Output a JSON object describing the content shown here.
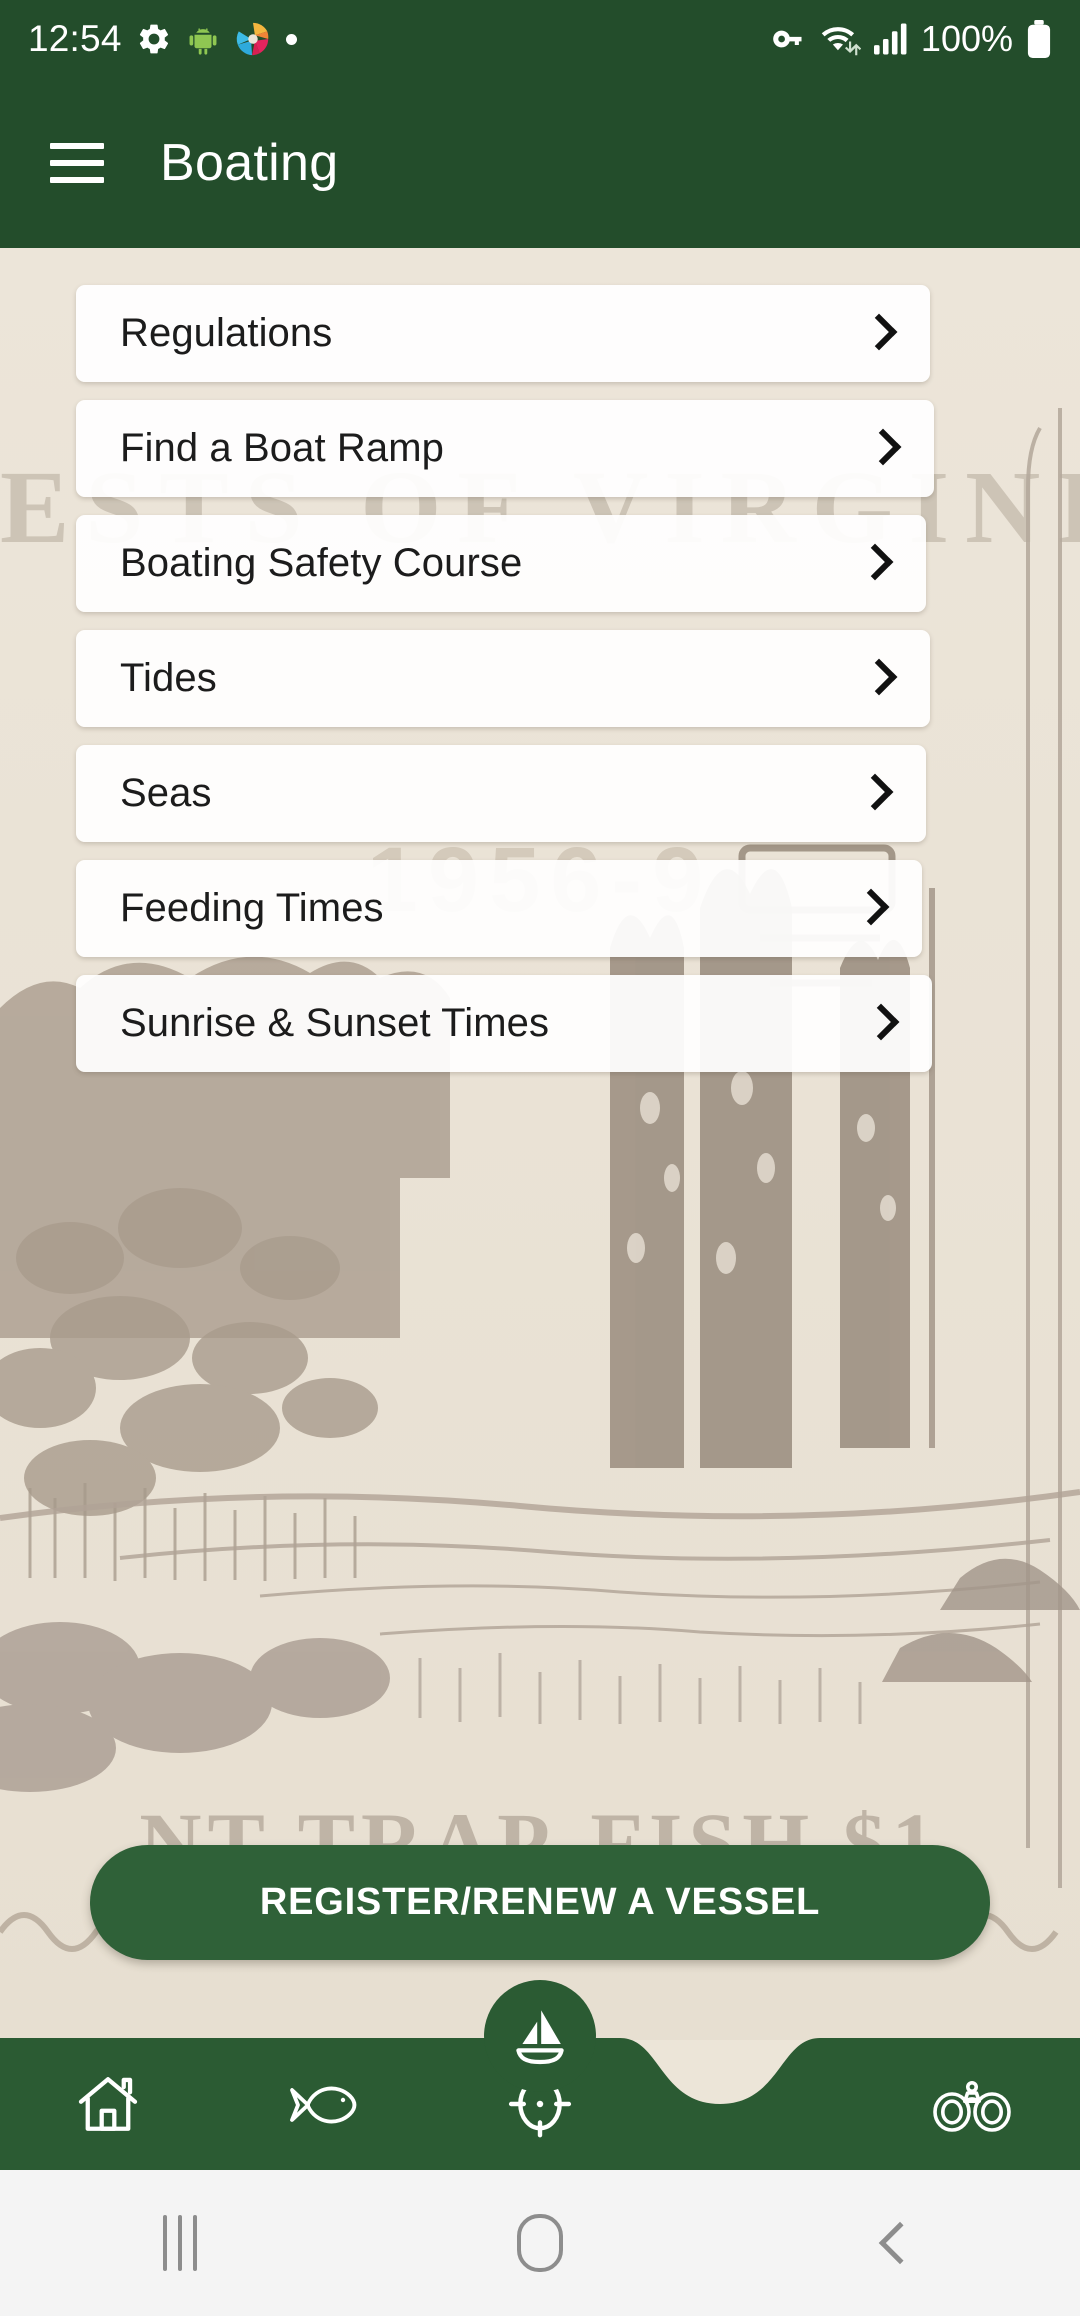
{
  "status_bar": {
    "time": "12:54",
    "battery_percent": "100%",
    "icons": [
      "gear-icon",
      "android-robot-icon",
      "color-swirl-icon",
      "dot-icon",
      "vpn-key-icon",
      "wifi-icon",
      "cellular-signal-icon",
      "battery-icon"
    ]
  },
  "app_bar": {
    "menu_icon": "hamburger-menu-icon",
    "title": "Boating"
  },
  "menu": {
    "items": [
      {
        "label": "Regulations",
        "chevron": "chevron-right-icon"
      },
      {
        "label": "Find a Boat Ramp",
        "chevron": "chevron-right-icon"
      },
      {
        "label": "Boating Safety Course",
        "chevron": "chevron-right-icon"
      },
      {
        "label": "Tides",
        "chevron": "chevron-right-icon"
      },
      {
        "label": "Seas",
        "chevron": "chevron-right-icon"
      },
      {
        "label": "Feeding Times",
        "chevron": "chevron-right-icon"
      },
      {
        "label": "Sunrise & Sunset Times",
        "chevron": "chevron-right-icon"
      }
    ]
  },
  "background_artwork": {
    "headline_text": "ESTS  OF  VIRGINIA",
    "year_text": "1956-9",
    "footer_text": "NT-TRAP-FISH   $1"
  },
  "primary_action": {
    "label": "REGISTER/RENEW A VESSEL"
  },
  "bottom_nav": {
    "items": [
      {
        "name": "home",
        "icon": "home-icon"
      },
      {
        "name": "fish",
        "icon": "fish-icon"
      },
      {
        "name": "locate",
        "icon": "crosshair-target-icon"
      },
      {
        "name": "binoculars",
        "icon": "binoculars-icon"
      }
    ],
    "fab": {
      "icon": "sailboat-icon"
    }
  },
  "system_nav": {
    "recents": "recents-icon",
    "home": "home-button-icon",
    "back": "back-icon"
  },
  "colors": {
    "brand_green": "#234d2b",
    "button_green": "#2f6138",
    "fab_green": "#2b5b33",
    "paper": "#ece5d9",
    "card": "#ffffff"
  }
}
